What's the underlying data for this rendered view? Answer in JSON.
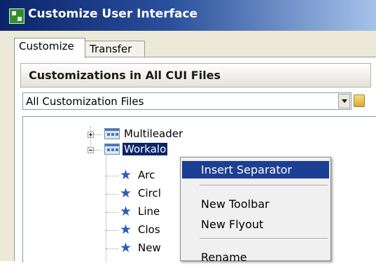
{
  "window": {
    "title": "Customize User Interface"
  },
  "tabs": [
    {
      "label": "Customize",
      "active": true
    },
    {
      "label": "Transfer",
      "active": false
    }
  ],
  "group": {
    "header": "Customizations in All CUI Files"
  },
  "file_filter": {
    "selected": "All Customization Files"
  },
  "tree": {
    "items": [
      {
        "label": "Multileader",
        "type": "toolbar",
        "state": "collapsed"
      },
      {
        "label": "Workalo",
        "type": "toolbar",
        "state": "expanded",
        "selected": true
      },
      {
        "label": "Arc",
        "type": "command"
      },
      {
        "label": "Circl",
        "type": "command"
      },
      {
        "label": "Line",
        "type": "command"
      },
      {
        "label": "Clos",
        "type": "command"
      },
      {
        "label": "New",
        "type": "command"
      }
    ]
  },
  "context_menu": {
    "items": [
      {
        "label": "Insert Separator",
        "highlighted": true
      },
      {
        "label": "New Toolbar"
      },
      {
        "label": "New Flyout"
      },
      {
        "label": "Rename"
      }
    ]
  },
  "colors": {
    "title_gradient_start": "#0a246a",
    "selection": "#0a246a",
    "menu_highlight": "#1c3f94",
    "command_icon": "#2e5cb8"
  }
}
